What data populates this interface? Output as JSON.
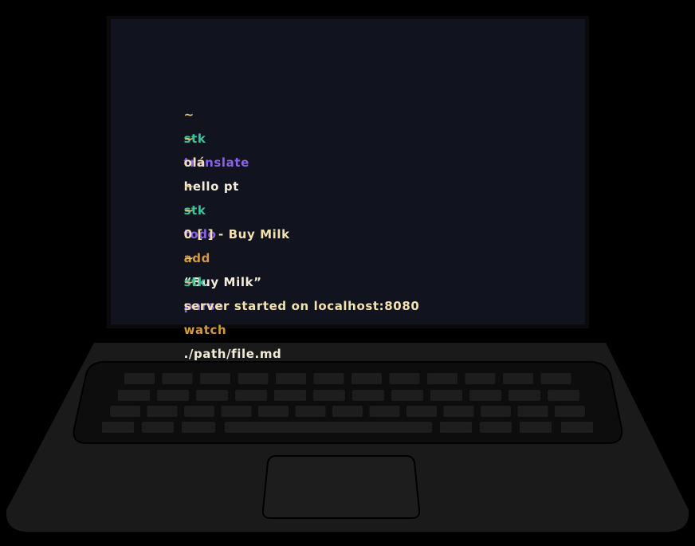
{
  "colors": {
    "background": "#000000",
    "screen": "#11131f",
    "laptop_body": "#1a1a1a",
    "prompt": "#e8c07a",
    "stk": "#34c79a",
    "subcommand": "#8a63e8",
    "action": "#d19a3f",
    "argument": "#f3ecdb",
    "output": "#f2e2b0"
  },
  "terminal": {
    "cmd1": {
      "prompt": "~",
      "stk": "stk",
      "sub": "translate",
      "args": "hello pt"
    },
    "out1": {
      "prompt": "~",
      "text": "olá"
    },
    "cmd2": {
      "prompt": "~",
      "stk": "stk",
      "sub": "todo",
      "action": "add",
      "args": "“Buy Milk”"
    },
    "out2": {
      "prompt": "~",
      "text": "0 [ ] - Buy Milk"
    },
    "cmd3": {
      "prompt": "~",
      "stk": "stk",
      "sub": "parse",
      "action": "watch",
      "args": "./path/file.md"
    },
    "out3": {
      "prompt": "~",
      "text": "server started on localhost:8080"
    }
  }
}
